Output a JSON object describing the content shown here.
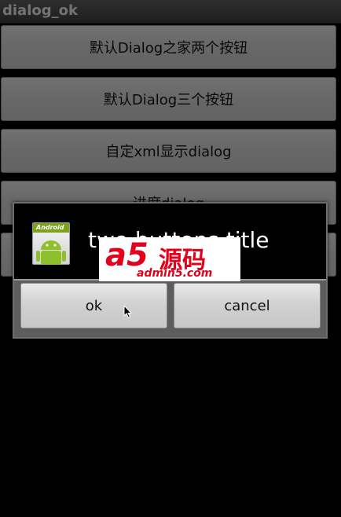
{
  "app": {
    "title": "dialog_ok"
  },
  "buttons": [
    {
      "label": "默认Dialog之家两个按钮"
    },
    {
      "label": "默认Dialog三个按钮"
    },
    {
      "label": "自定xml显示dialog"
    },
    {
      "label": "进度dialog"
    },
    {
      "label": ""
    }
  ],
  "dialog": {
    "icon_text": "Android",
    "title": "two buttons title",
    "ok_label": "ok",
    "cancel_label": "cancel"
  },
  "watermark": {
    "logo_text": "a5",
    "cn_text": "源码",
    "url": "admin5.com"
  },
  "colors": {
    "watermark_red": "#e3001b",
    "android_green": "#7fa21e"
  },
  "icons": [
    "android-app-icon",
    "mouse-cursor-icon"
  ]
}
